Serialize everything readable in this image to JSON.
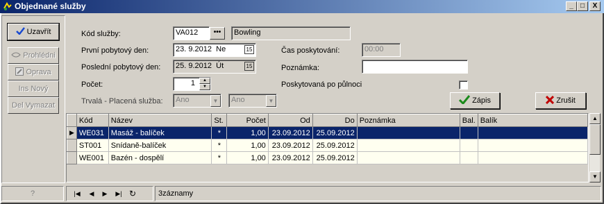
{
  "window": {
    "title": "Objednané služby",
    "controls": {
      "minimize": "_",
      "restore": "□",
      "close": "X"
    }
  },
  "toolbar": {
    "close_label": "Uzavřít",
    "view_label": "Prohlédni",
    "edit_label": "Oprava",
    "new_label": "Ins Nový",
    "delete_label": "Del Vymazat"
  },
  "form": {
    "service_code": {
      "label": "Kód služby:",
      "value": "VA012",
      "description": "Bowling",
      "browse": "•••"
    },
    "first_day": {
      "label": "První pobytový den:",
      "date": "23. 9.2012",
      "weekday": "Ne",
      "cal": "15"
    },
    "last_day": {
      "label": "Poslední pobytový den:",
      "date": "25. 9.2012",
      "weekday": "Út",
      "cal": "15"
    },
    "count": {
      "label": "Počet:",
      "value": "1"
    },
    "permanent": {
      "label": "Trvalá - Placená služba:",
      "value1": "Ano",
      "value2": "Ano"
    },
    "time": {
      "label": "Čas poskytování:",
      "value": "00:00"
    },
    "note": {
      "label": "Poznámka:",
      "value": ""
    },
    "after_midnight": {
      "label": "Poskytovaná po půlnoci",
      "checked": false
    },
    "save_label": "Zápis",
    "cancel_label": "Zrušit"
  },
  "grid": {
    "columns": [
      "Kód",
      "Název",
      "St.",
      "Počet",
      "Od",
      "Do",
      "Poznámka",
      "Bal.",
      "Balík"
    ],
    "rows": [
      {
        "code": "WE031",
        "name": "Masáž - balíček",
        "st": "*",
        "count": "1,00",
        "from": "23.09.2012",
        "to": "25.09.2012",
        "note": "",
        "bal": "",
        "package": "",
        "selected": true
      },
      {
        "code": "ST001",
        "name": "Snídaně-balíček",
        "st": "*",
        "count": "1,00",
        "from": "23.09.2012",
        "to": "25.09.2012",
        "note": "",
        "bal": "",
        "package": "",
        "selected": false
      },
      {
        "code": "WE001",
        "name": "Bazén - dospělí",
        "st": "*",
        "count": "1,00",
        "from": "23.09.2012",
        "to": "25.09.2012",
        "note": "",
        "bal": "",
        "package": "",
        "selected": false
      }
    ]
  },
  "status": {
    "help": "?",
    "records": "3záznamy"
  },
  "colors": {
    "title_start": "#0a246a",
    "title_end": "#a6caf0",
    "selection": "#0a246a",
    "row_bg": "#fffff0",
    "check": "#1a8a1a",
    "cancel_x": "#c00000"
  }
}
